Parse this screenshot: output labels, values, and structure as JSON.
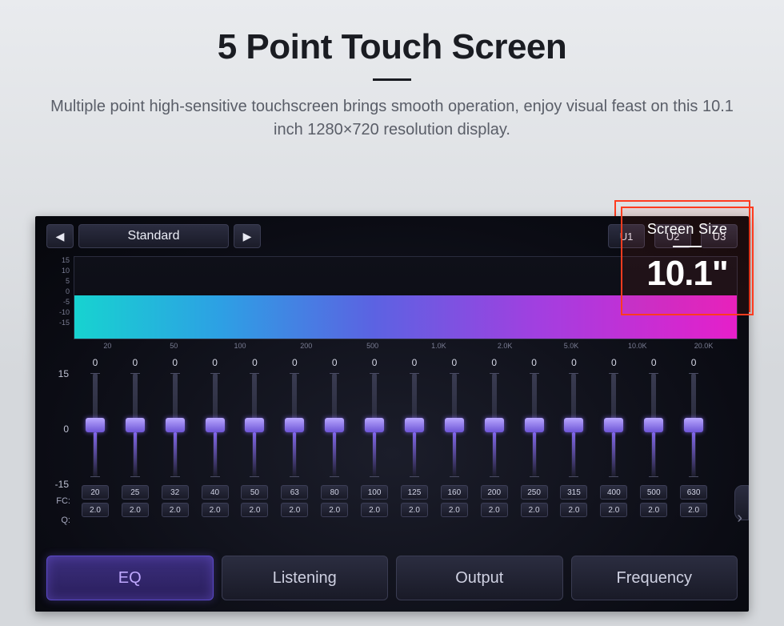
{
  "hero": {
    "title": "5 Point Touch Screen",
    "subtitle": "Multiple point high-sensitive touchscreen brings smooth operation, enjoy visual feast on this 10.1 inch 1280×720 resolution display."
  },
  "callout": {
    "label": "Screen Size",
    "value": "10.1\""
  },
  "eq": {
    "preset": "Standard",
    "user_presets": [
      "U1",
      "U2",
      "U3"
    ],
    "spectrum": {
      "y_ticks": [
        "15",
        "10",
        "5",
        "0",
        "-5",
        "-10",
        "-15"
      ],
      "x_ticks": [
        "20",
        "50",
        "100",
        "200",
        "500",
        "1.0K",
        "2.0K",
        "5.0K",
        "10.0K",
        "20.0K"
      ]
    },
    "slider_y_ticks": [
      "15",
      "0",
      "-15"
    ],
    "row_labels": {
      "fc": "FC:",
      "q": "Q:"
    },
    "bands": [
      {
        "gain": "0",
        "fc": "20",
        "q": "2.0"
      },
      {
        "gain": "0",
        "fc": "25",
        "q": "2.0"
      },
      {
        "gain": "0",
        "fc": "32",
        "q": "2.0"
      },
      {
        "gain": "0",
        "fc": "40",
        "q": "2.0"
      },
      {
        "gain": "0",
        "fc": "50",
        "q": "2.0"
      },
      {
        "gain": "0",
        "fc": "63",
        "q": "2.0"
      },
      {
        "gain": "0",
        "fc": "80",
        "q": "2.0"
      },
      {
        "gain": "0",
        "fc": "100",
        "q": "2.0"
      },
      {
        "gain": "0",
        "fc": "125",
        "q": "2.0"
      },
      {
        "gain": "0",
        "fc": "160",
        "q": "2.0"
      },
      {
        "gain": "0",
        "fc": "200",
        "q": "2.0"
      },
      {
        "gain": "0",
        "fc": "250",
        "q": "2.0"
      },
      {
        "gain": "0",
        "fc": "315",
        "q": "2.0"
      },
      {
        "gain": "0",
        "fc": "400",
        "q": "2.0"
      },
      {
        "gain": "0",
        "fc": "500",
        "q": "2.0"
      },
      {
        "gain": "0",
        "fc": "630",
        "q": "2.0"
      }
    ],
    "tabs": [
      "EQ",
      "Listening",
      "Output",
      "Frequency"
    ],
    "active_tab": 0
  }
}
